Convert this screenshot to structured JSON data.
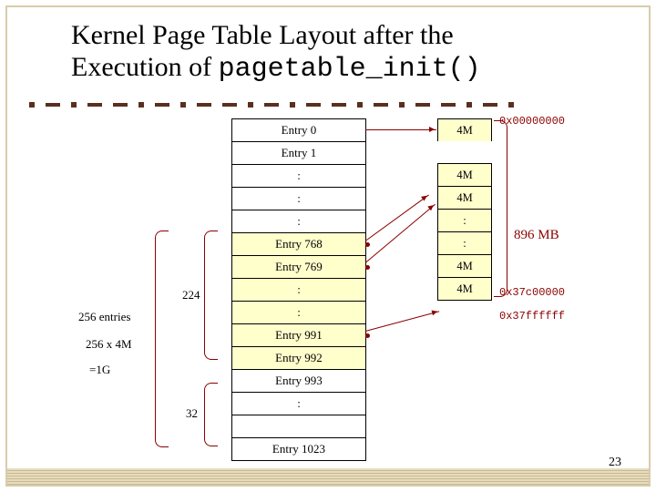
{
  "title_line1": "Kernel Page Table Layout after the",
  "title_line2_a": "Execution of ",
  "title_line2_code": "pagetable_init()",
  "page_number": "23",
  "left_table": {
    "rows": [
      {
        "label": "Entry 0",
        "y": false,
        "dot": false
      },
      {
        "label": "Entry 1",
        "y": false,
        "dot": false
      },
      {
        "label": ":",
        "y": false,
        "dot": false
      },
      {
        "label": ":",
        "y": false,
        "dot": false
      },
      {
        "label": ":",
        "y": false,
        "dot": false
      },
      {
        "label": "Entry 768",
        "y": true,
        "dot": true
      },
      {
        "label": "Entry 769",
        "y": true,
        "dot": true
      },
      {
        "label": ":",
        "y": true,
        "dot": false
      },
      {
        "label": ":",
        "y": true,
        "dot": false
      },
      {
        "label": "Entry 991",
        "y": true,
        "dot": true
      },
      {
        "label": "Entry 992",
        "y": true,
        "dot": false
      },
      {
        "label": "Entry 993",
        "y": false,
        "dot": false
      },
      {
        "label": ":",
        "y": false,
        "dot": false
      },
      {
        "label": "",
        "y": false,
        "dot": false
      },
      {
        "label": "Entry 1023",
        "y": false,
        "dot": false
      }
    ]
  },
  "mem_cells": [
    "4M",
    "4M",
    "4M",
    ":",
    ":",
    "4M",
    "4M"
  ],
  "addr_top": "0x00000000",
  "addr_mid": "0x37c00000",
  "addr_bot": "0x37ffffff",
  "mb_label": "896 MB",
  "brace_224": "224",
  "brace_32": "32",
  "note_256entries": "256 entries",
  "note_256x4m": "256 x 4M",
  "note_eq1g": "=1G"
}
